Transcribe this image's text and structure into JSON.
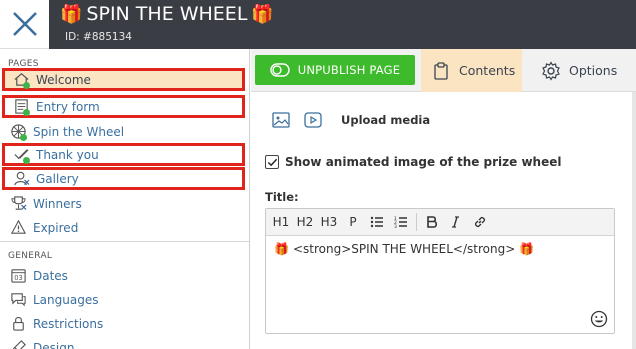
{
  "header": {
    "close_icon": "close-icon",
    "gift_glyph": "🎁",
    "title": "SPIN THE WHEEL",
    "id_text": "ID: #885134"
  },
  "sidebar": {
    "pages_label": "PAGES",
    "pages": [
      {
        "label": "Welcome",
        "icon": "home-icon",
        "status": "green-dot",
        "active": true,
        "outlined": true
      },
      {
        "label": "Entry form",
        "icon": "form-icon",
        "status": "green-dot",
        "active": false,
        "outlined": true
      },
      {
        "label": "Spin the Wheel",
        "icon": "wheel-icon",
        "status": "green-dot",
        "active": false,
        "outlined": false
      },
      {
        "label": "Thank you",
        "icon": "check-icon",
        "status": "green-dot",
        "active": false,
        "outlined": true
      },
      {
        "label": "Gallery",
        "icon": "user-icon",
        "status": "x-mark",
        "active": false,
        "outlined": true
      },
      {
        "label": "Winners",
        "icon": "trophy-icon",
        "status": "x-mark",
        "active": false,
        "outlined": false
      },
      {
        "label": "Expired",
        "icon": "warning-icon",
        "status": "none",
        "active": false,
        "outlined": false
      }
    ],
    "general_label": "GENERAL",
    "general": [
      {
        "label": "Dates",
        "icon": "calendar-icon"
      },
      {
        "label": "Languages",
        "icon": "chat-icon"
      },
      {
        "label": "Restrictions",
        "icon": "lock-icon"
      },
      {
        "label": "Design",
        "icon": "brush-icon"
      }
    ]
  },
  "toolbar": {
    "unpublish_label": "UNPUBLISH PAGE",
    "contents_tab": "Contents",
    "options_tab": "Options"
  },
  "main": {
    "upload_media_label": "Upload media",
    "show_animated_label": "Show animated image of the prize wheel",
    "show_animated_checked": true,
    "title_label": "Title:",
    "editor_buttons": [
      "H1",
      "H2",
      "H3",
      "P"
    ],
    "editor_content": "<strong>SPIN THE WHEEL</strong>"
  },
  "colors": {
    "topbar": "#3a3d44",
    "active_bg": "#fbe4c2",
    "outline_red": "#e0231b",
    "publish_green": "#3dbb2c",
    "status_green": "#3eb34a",
    "link_blue": "#3a6f9e"
  }
}
